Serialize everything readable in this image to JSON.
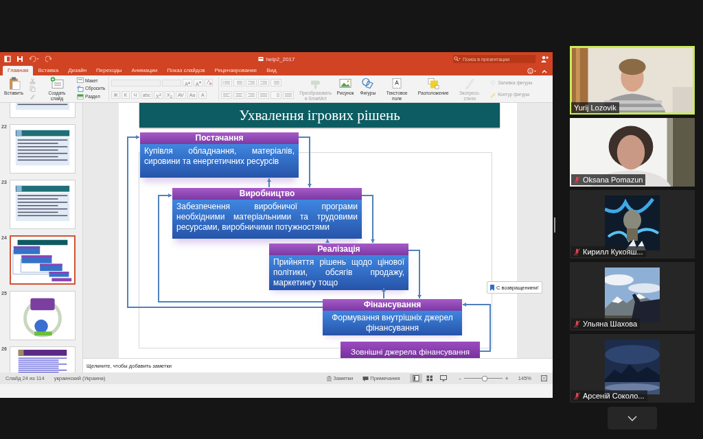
{
  "window": {
    "title": "help2_2017",
    "search": {
      "placeholder": "Поиск в презентации"
    }
  },
  "tabs": [
    {
      "label": "Главная",
      "selected": true
    },
    {
      "label": "Вставка",
      "selected": false
    },
    {
      "label": "Дизайн",
      "selected": false
    },
    {
      "label": "Переходы",
      "selected": false
    },
    {
      "label": "Анимации",
      "selected": false
    },
    {
      "label": "Показ слайдов",
      "selected": false
    },
    {
      "label": "Рецензирование",
      "selected": false
    },
    {
      "label": "Вид",
      "selected": false
    }
  ],
  "ribbon": [
    {
      "kind": "large",
      "label": "Вставить",
      "disabled": false
    },
    {
      "kind": "tools"
    },
    {
      "kind": "large",
      "label": "Создать слайд",
      "disabled": false
    },
    {
      "kind": "stack",
      "items": [
        {
          "label": "Макет",
          "disabled": false
        },
        {
          "label": "Сбросить",
          "disabled": false
        },
        {
          "label": "Раздел",
          "disabled": false
        }
      ]
    },
    {
      "kind": "font",
      "disabled": true,
      "size_buttons": [
        "A$^{▴}$",
        "A$^{▾}$"
      ],
      "buttons": [
        "Ж",
        "К",
        "Ч",
        "abc",
        "X$^{2}$",
        "X$_{2}$",
        "AV",
        "Aa",
        "A"
      ]
    },
    {
      "kind": "paragraph"
    },
    {
      "kind": "large",
      "label": "Преобразовать в SmartArt",
      "disabled": true
    },
    {
      "kind": "large",
      "label": "Рисунок",
      "disabled": false
    },
    {
      "kind": "large",
      "label": "Фигуры",
      "disabled": false
    },
    {
      "kind": "large",
      "label": "Текстовое поле",
      "disabled": false
    },
    {
      "kind": "large",
      "label": "Расположение",
      "disabled": false
    },
    {
      "kind": "large",
      "label": "Экспресс-стили",
      "disabled": true
    },
    {
      "kind": "stack",
      "items": [
        {
          "label": "Заливка фигуры",
          "disabled": true
        },
        {
          "label": "Контур фигуры",
          "disabled": true
        }
      ]
    }
  ],
  "thumbnails": [
    {
      "kind": "text",
      "selected": false
    },
    {
      "number": "22",
      "kind": "text",
      "selected": false
    },
    {
      "number": "23",
      "kind": "text",
      "selected": false
    },
    {
      "number": "24",
      "kind": "diagram",
      "selected": true
    },
    {
      "number": "25",
      "kind": "circle",
      "selected": false
    },
    {
      "number": "26",
      "kind": "links",
      "selected": false
    }
  ],
  "slide": {
    "title": "Ухвалення ігрових рішень",
    "blocks": [
      {
        "heading": "Постачання",
        "text": "Купівля обладнання, матеріалів, сировини та енергетичних ресурсів"
      },
      {
        "heading": "Виробництво",
        "text": "Забезпечення виробничої програми необхідними матеріальними та трудовими ресурсами, виробничими потужностями"
      },
      {
        "heading": "Реалізація",
        "text": "Прийняття рішень щодо цінової політики, обсягів продажу, маркетингу тощо"
      },
      {
        "heading": "Фінансування",
        "text": "Формування внутрішніх джерел фінансування"
      }
    ],
    "external_box": "Зовнішні джерела фінансування"
  },
  "notice": "С возвращением!",
  "notes": {
    "placeholder": "Щелкните, чтобы добавить заметки"
  },
  "status_bar": {
    "slide_info": "Слайд 24 из 114",
    "language": "украинский (Украина)",
    "buttons": [
      "Заметки",
      "Примечания"
    ],
    "views": [
      {
        "selected": true
      },
      {
        "selected": false
      },
      {
        "selected": false
      }
    ],
    "zoom": {
      "out": "-",
      "in": "+",
      "level": 0.55,
      "value": "145%"
    }
  },
  "participants": [
    {
      "name": "Yurij Lozovik",
      "kind": "video",
      "muted": false,
      "speaking": true
    },
    {
      "name": "Oksana Pomazun",
      "kind": "video",
      "muted": true,
      "speaking": false
    },
    {
      "name": "Кирилл Кукояш...",
      "kind": "avatar",
      "muted": true,
      "speaking": false
    },
    {
      "name": "Ульяна Шахова",
      "kind": "avatar",
      "muted": true,
      "speaking": false
    },
    {
      "name": "Арсеній Соколо...",
      "kind": "avatar",
      "muted": true,
      "speaking": false
    }
  ]
}
